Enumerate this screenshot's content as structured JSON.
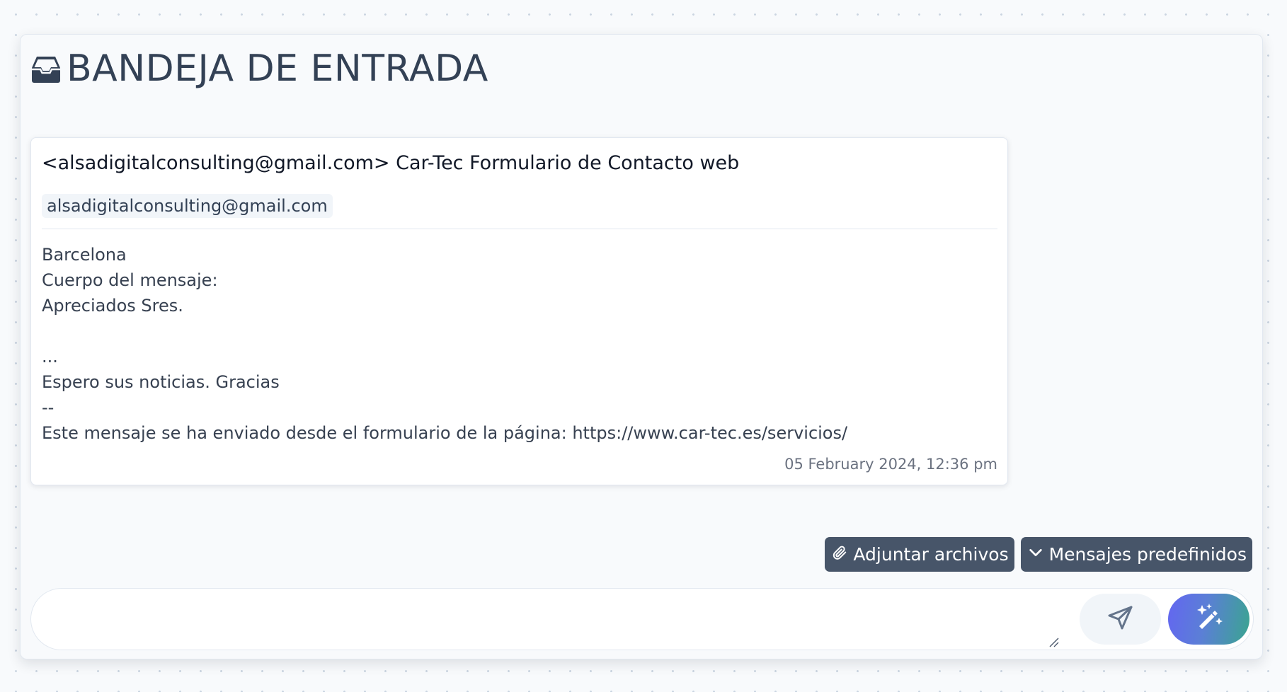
{
  "header": {
    "icon": "inbox-icon",
    "title": "BANDEJA DE ENTRADA"
  },
  "email": {
    "subject": "<alsadigitalconsulting@gmail.com> Car-Tec Formulario de Contacto web",
    "sender": "alsadigitalconsulting@gmail.com",
    "body_lines": [
      "Barcelona",
      "Cuerpo del mensaje:",
      "Apreciados Sres.",
      "",
      "...",
      "Espero sus noticias. Gracias",
      "--",
      "Este mensaje se ha enviado desde el formulario de la página: https://www.car-tec.es/servicios/"
    ],
    "date": "05 February 2024, 12:36 pm"
  },
  "actions": {
    "attach_label": "Adjuntar archivos",
    "attach_icon": "paperclip-icon",
    "predefined_label": "Mensajes predefinidos",
    "predefined_icon": "chevron-down-icon"
  },
  "composer": {
    "value": "",
    "placeholder": "",
    "send_icon": "send-icon",
    "ai_icon": "magic-wand-icon"
  },
  "colors": {
    "title": "#334155",
    "action_button_bg": "#475569",
    "ai_gradient_start": "#6366f1",
    "ai_gradient_end": "#3aa58f"
  }
}
